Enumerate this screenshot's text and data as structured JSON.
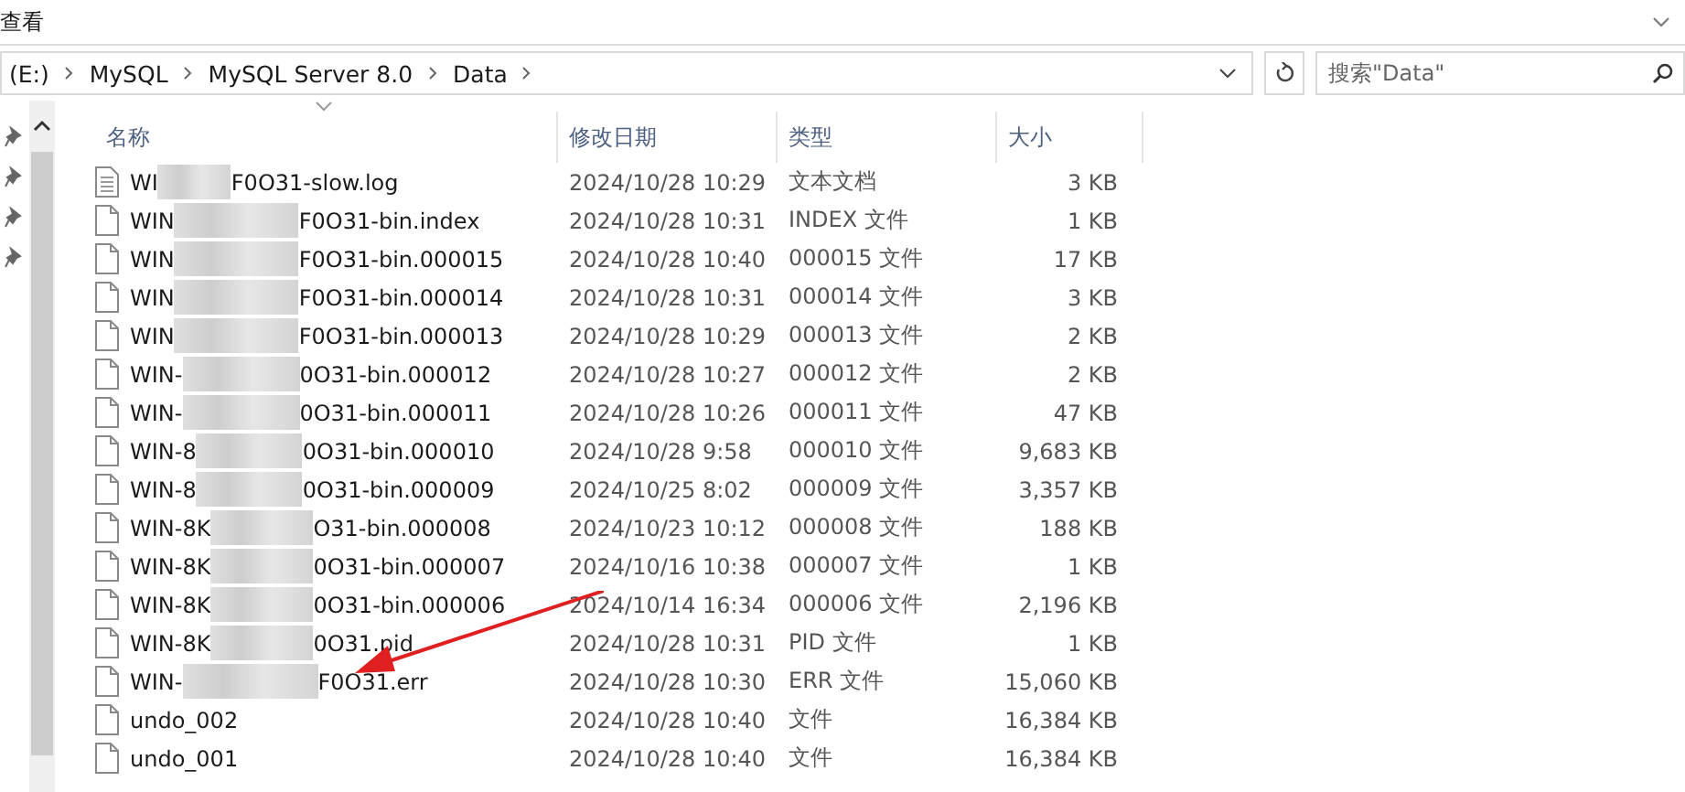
{
  "ribbon": {
    "tab": "查看"
  },
  "address": {
    "crumbs": [
      "(E:)",
      "MySQL",
      "MySQL Server 8.0",
      "Data"
    ]
  },
  "search": {
    "placeholder": "搜索\"Data\""
  },
  "columns": [
    "名称",
    "修改日期",
    "类型",
    "大小"
  ],
  "files": [
    {
      "kind": "text",
      "name_start": "WI",
      "name_end": "F0O31-slow.log",
      "modified": "2024/10/28 10:29",
      "type": "文本文档",
      "size": "3 KB"
    },
    {
      "kind": "file",
      "name_start": "WIN",
      "name_end": "F0O31-bin.index",
      "modified": "2024/10/28 10:31",
      "type": "INDEX 文件",
      "size": "1 KB"
    },
    {
      "kind": "file",
      "name_start": "WIN",
      "name_end": "F0O31-bin.000015",
      "modified": "2024/10/28 10:40",
      "type": "000015 文件",
      "size": "17 KB"
    },
    {
      "kind": "file",
      "name_start": "WIN",
      "name_end": "F0O31-bin.000014",
      "modified": "2024/10/28 10:31",
      "type": "000014 文件",
      "size": "3 KB"
    },
    {
      "kind": "file",
      "name_start": "WIN",
      "name_end": "F0O31-bin.000013",
      "modified": "2024/10/28 10:29",
      "type": "000013 文件",
      "size": "2 KB"
    },
    {
      "kind": "file",
      "name_start": "WIN-",
      "name_end": "0O31-bin.000012",
      "modified": "2024/10/28 10:27",
      "type": "000012 文件",
      "size": "2 KB"
    },
    {
      "kind": "file",
      "name_start": "WIN-",
      "name_end": "0O31-bin.000011",
      "modified": "2024/10/28 10:26",
      "type": "000011 文件",
      "size": "47 KB"
    },
    {
      "kind": "file",
      "name_start": "WIN-8",
      "name_end": "0O31-bin.000010",
      "modified": "2024/10/28 9:58",
      "type": "000010 文件",
      "size": "9,683 KB"
    },
    {
      "kind": "file",
      "name_start": "WIN-8",
      "name_end": "0O31-bin.000009",
      "modified": "2024/10/25 8:02",
      "type": "000009 文件",
      "size": "3,357 KB"
    },
    {
      "kind": "file",
      "name_start": "WIN-8K",
      "name_end": "O31-bin.000008",
      "modified": "2024/10/23 10:12",
      "type": "000008 文件",
      "size": "188 KB"
    },
    {
      "kind": "file",
      "name_start": "WIN-8K",
      "name_end": "0O31-bin.000007",
      "modified": "2024/10/16 10:38",
      "type": "000007 文件",
      "size": "1 KB"
    },
    {
      "kind": "file",
      "name_start": "WIN-8K",
      "name_end": "0O31-bin.000006",
      "modified": "2024/10/14 16:34",
      "type": "000006 文件",
      "size": "2,196 KB"
    },
    {
      "kind": "file",
      "name_start": "WIN-8K",
      "name_end": "0O31.pid",
      "modified": "2024/10/28 10:31",
      "type": "PID 文件",
      "size": "1 KB"
    },
    {
      "kind": "file",
      "name_start": "WIN-",
      "name_end": "F0O31.err",
      "modified": "2024/10/28 10:30",
      "type": "ERR 文件",
      "size": "15,060 KB"
    },
    {
      "kind": "file",
      "name_start": "undo_002",
      "modified": "2024/10/28 10:40",
      "type": "文件",
      "size": "16,384 KB"
    },
    {
      "kind": "file",
      "name_start": "undo_001",
      "modified": "2024/10/28 10:40",
      "type": "文件",
      "size": "16,384 KB"
    }
  ]
}
